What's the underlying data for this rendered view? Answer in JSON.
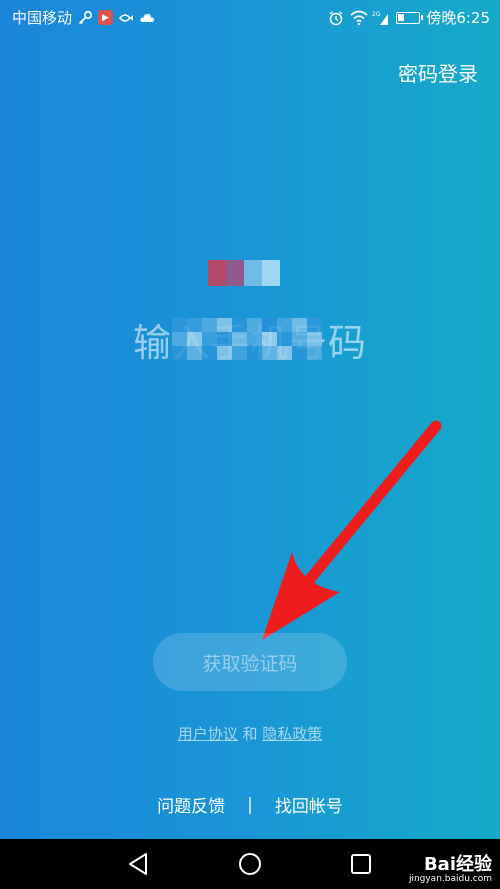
{
  "status_bar": {
    "carrier": "中国移动",
    "network": "2G",
    "time": "傍晚6:25",
    "icons": [
      "key-icon",
      "video-app-icon",
      "fish-icon",
      "cloud-icon",
      "alarm-icon",
      "wifi-icon",
      "signal-icon",
      "battery-icon"
    ]
  },
  "header": {
    "password_login": "密码登录"
  },
  "main": {
    "title": "输入手机号码",
    "get_code_button": "获取验证码"
  },
  "agreement": {
    "user_agreement": "用户协议",
    "and": "和",
    "privacy_policy": "隐私政策"
  },
  "footer": {
    "feedback": "问题反馈",
    "separator": "|",
    "recover_account": "找回帐号"
  },
  "nav_bar": {
    "icons": [
      "back-icon",
      "home-icon",
      "recents-icon"
    ]
  },
  "watermark": {
    "brand": "Bai经验",
    "url": "jingyan.baidu.com"
  },
  "colors": {
    "bg_left": "#1a86d9",
    "bg_right": "#15aac8",
    "arrow": "#ee1c1c",
    "nav_bar": "#000000"
  }
}
